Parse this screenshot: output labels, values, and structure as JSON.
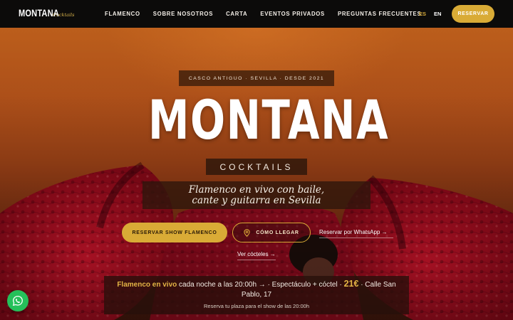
{
  "nav": {
    "logo_main": "MONTANA",
    "logo_sub": "Cocktails",
    "menu": [
      {
        "label": "FLAMENCO"
      },
      {
        "label": "SOBRE NOSOTROS"
      },
      {
        "label": "CARTA"
      },
      {
        "label": "EVENTOS PRIVADOS"
      },
      {
        "label": "PREGUNTAS FRECUENTES"
      }
    ],
    "lang_es": "ES",
    "lang_en": "EN",
    "reserve_label": "RESERVAR"
  },
  "hero": {
    "eyebrow": "CASCO ANTIGUO · SEVILLA · DESDE 2021",
    "title": "MONTANA",
    "subtitle": "COCKTAILS",
    "tagline_line1": "Flamenco en vivo con baile,",
    "tagline_line2": "cante y guitarra en Sevilla"
  },
  "cta": {
    "primary_label": "RESERVAR SHOW FLAMENCO",
    "directions_label": "CÓMO LLEGAR",
    "whatsapp_link": "Reservar por WhatsApp →",
    "cocktails_link": "Ver cócteles →"
  },
  "info": {
    "highlight": "Flamenco en vivo",
    "text_a": "cada noche a las 20:00h → · Espectáculo + cóctel ·",
    "price": "21€",
    "text_b": "· Calle San Pablo, 17",
    "subtext": "Reserva tu plaza para el show de las 20:00h"
  },
  "icons": {
    "location": "map-pin-icon",
    "whatsapp": "whatsapp-icon"
  },
  "colors": {
    "accent": "#d9ab36",
    "nav_bg": "#0c0b0a",
    "whatsapp": "#25c05a"
  }
}
